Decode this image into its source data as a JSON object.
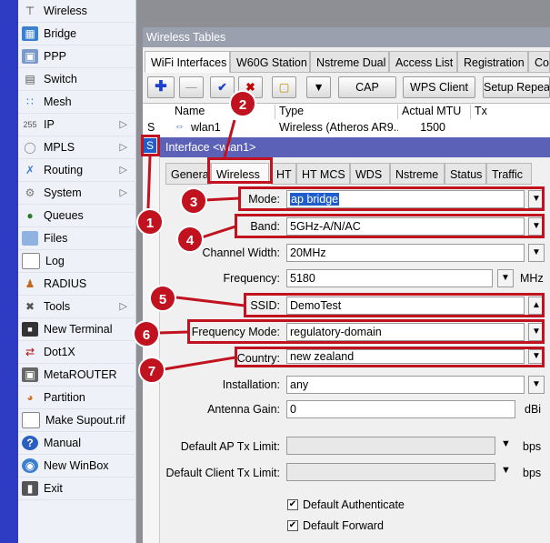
{
  "sidebar": {
    "items": [
      {
        "label": "Wireless",
        "icon": "antenna-icon",
        "arrow": false
      },
      {
        "label": "Bridge",
        "icon": "bridge-icon",
        "arrow": false
      },
      {
        "label": "PPP",
        "icon": "ppp-icon",
        "arrow": false
      },
      {
        "label": "Switch",
        "icon": "switch-icon",
        "arrow": false
      },
      {
        "label": "Mesh",
        "icon": "mesh-icon",
        "arrow": false
      },
      {
        "label": "IP",
        "icon": "ip-icon",
        "arrow": true
      },
      {
        "label": "MPLS",
        "icon": "mpls-icon",
        "arrow": true
      },
      {
        "label": "Routing",
        "icon": "routing-icon",
        "arrow": true
      },
      {
        "label": "System",
        "icon": "gear-icon",
        "arrow": true
      },
      {
        "label": "Queues",
        "icon": "queues-icon",
        "arrow": false
      },
      {
        "label": "Files",
        "icon": "folder-icon",
        "arrow": false
      },
      {
        "label": "Log",
        "icon": "log-icon",
        "arrow": false
      },
      {
        "label": "RADIUS",
        "icon": "radius-icon",
        "arrow": false
      },
      {
        "label": "Tools",
        "icon": "tools-icon",
        "arrow": true
      },
      {
        "label": "New Terminal",
        "icon": "terminal-icon",
        "arrow": false
      },
      {
        "label": "Dot1X",
        "icon": "dot1x-icon",
        "arrow": false
      },
      {
        "label": "MetaROUTER",
        "icon": "metarouter-icon",
        "arrow": false
      },
      {
        "label": "Partition",
        "icon": "partition-icon",
        "arrow": false
      },
      {
        "label": "Make Supout.rif",
        "icon": "document-icon",
        "arrow": false
      },
      {
        "label": "Manual",
        "icon": "help-icon",
        "arrow": false
      },
      {
        "label": "New WinBox",
        "icon": "winbox-icon",
        "arrow": false
      },
      {
        "label": "Exit",
        "icon": "exit-icon",
        "arrow": false
      }
    ]
  },
  "wireless_tables": {
    "title": "Wireless Tables",
    "tabs": [
      "WiFi Interfaces",
      "W60G Station",
      "Nstreme Dual",
      "Access List",
      "Registration",
      "Co"
    ],
    "toolbar": {
      "cap": "CAP",
      "wps_client": "WPS Client",
      "setup_repeater": "Setup Repea"
    },
    "columns": [
      "Name",
      "Type",
      "Actual MTU",
      "Tx"
    ],
    "rows": [
      {
        "flag": "S",
        "name": "wlan1",
        "type": "Wireless (Atheros AR9...",
        "mtu": "1500"
      }
    ]
  },
  "interface_dialog": {
    "title": "Interface <wlan1>",
    "s_marker": "S",
    "tabs": [
      "General",
      "Wireless",
      "HT",
      "HT MCS",
      "WDS",
      "Nstreme",
      "Status",
      "Traffic"
    ],
    "fields": {
      "mode": {
        "label": "Mode:",
        "value": "ap bridge"
      },
      "band": {
        "label": "Band:",
        "value": "5GHz-A/N/AC"
      },
      "channel_width": {
        "label": "Channel Width:",
        "value": "20MHz"
      },
      "frequency": {
        "label": "Frequency:",
        "value": "5180",
        "unit": "MHz"
      },
      "ssid": {
        "label": "SSID:",
        "value": "DemoTest"
      },
      "frequency_mode": {
        "label": "Frequency Mode:",
        "value": "regulatory-domain"
      },
      "country": {
        "label": "Country:",
        "value": "new zealand"
      },
      "installation": {
        "label": "Installation:",
        "value": "any"
      },
      "antenna_gain": {
        "label": "Antenna Gain:",
        "value": "0",
        "unit": "dBi"
      },
      "default_ap_tx_limit": {
        "label": "Default AP Tx Limit:",
        "value": "",
        "unit": "bps"
      },
      "default_client_tx_limit": {
        "label": "Default Client Tx Limit:",
        "value": "",
        "unit": "bps"
      }
    },
    "checkboxes": [
      {
        "label": "Default Authenticate",
        "checked": true
      },
      {
        "label": "Default Forward",
        "checked": true
      }
    ]
  },
  "annotations": [
    "1",
    "2",
    "3",
    "4",
    "5",
    "6",
    "7"
  ],
  "colors": {
    "highlight": "#c1121f",
    "title_bar": "#5a61b7",
    "left_bar": "#2d3cc2",
    "selection": "#1f5ccc"
  }
}
